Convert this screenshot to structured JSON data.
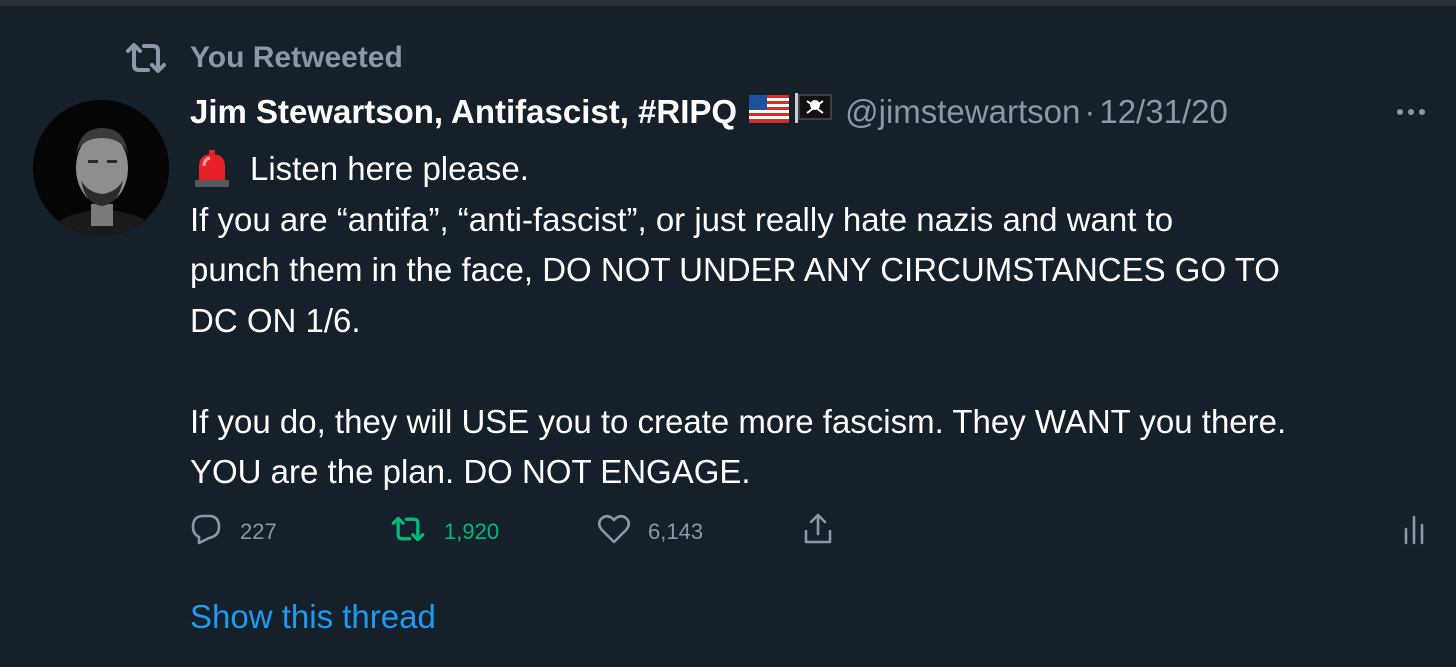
{
  "social_context": {
    "label": "You Retweeted",
    "icon": "retweet-icon"
  },
  "author": {
    "display_name": "Jim Stewartson, Antifascist, #RIPQ",
    "emoji_flags": [
      "us-flag-icon",
      "pirate-flag-icon"
    ],
    "handle": "@jimstewartson",
    "separator": "·",
    "date": "12/31/20"
  },
  "tweet": {
    "lines": [
      "Listen here please.",
      "If you are “antifa”, “anti-fascist”, or just really hate nazis and want to",
      "punch them in the face, DO NOT UNDER ANY CIRCUMSTANCES GO TO",
      "DC ON 1/6.",
      "If you do, they will USE you to create more fascism. They WANT you there.",
      "YOU are the plan. DO NOT ENGAGE."
    ],
    "lead_emoji": "siren-icon"
  },
  "actions": {
    "replies": "227",
    "retweets": "1,920",
    "likes": "6,143"
  },
  "show_thread": "Show this thread",
  "colors": {
    "background": "#15202b",
    "text_primary": "#ffffff",
    "text_secondary": "#8b98a5",
    "link": "#1d9bf0",
    "retweet_active": "#00ba7c"
  }
}
